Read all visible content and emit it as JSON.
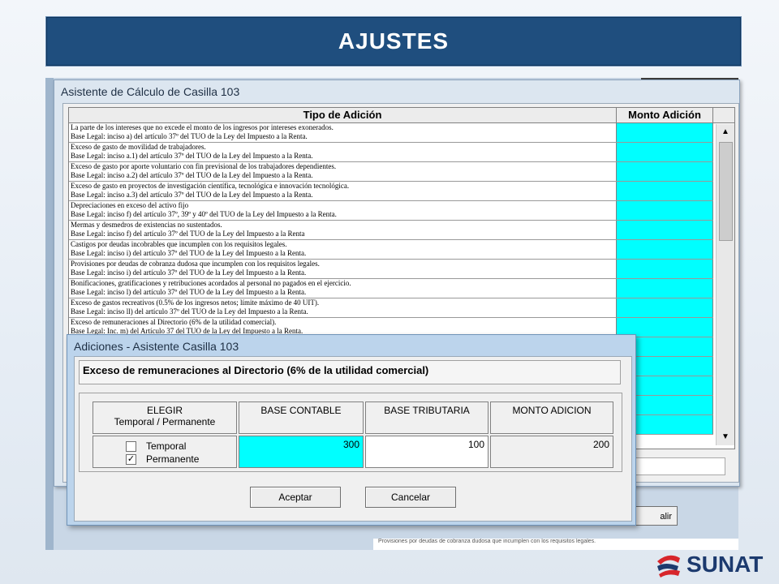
{
  "banner": {
    "title": "AJUSTES"
  },
  "background": {
    "button_label": "alir",
    "footer_text": "Provisiones por deudas de cobranza dudosa que incumplen con los requisitos legales."
  },
  "wizard": {
    "title": "Asistente de Cálculo de Casilla 103",
    "columns": {
      "tipo": "Tipo de Adición",
      "monto": "Monto Adición"
    },
    "rows": [
      {
        "line1": "La parte de los intereses que no excede el monto de los ingresos por intereses exonerados.",
        "line2": "Base Legal: inciso a) del artículo 37º del TUO de la Ley del Impuesto a la Renta."
      },
      {
        "line1": "Exceso de gasto de movilidad de trabajadores.",
        "line2": "Base Legal: inciso a.1) del artículo 37º del TUO de la Ley del Impuesto a la Renta."
      },
      {
        "line1": "Exceso de gasto por aporte voluntario con fin previsional de los trabajadores dependientes.",
        "line2": "Base Legal: inciso a.2) del artículo 37º del TUO de la Ley del Impuesto a la Renta."
      },
      {
        "line1": "Exceso de gasto en proyectos de investigación científica, tecnológica e innovación tecnológica.",
        "line2": "Base Legal: inciso a.3) del artículo 37º del TUO de la Ley del Impuesto a la Renta."
      },
      {
        "line1": "Depreciaciones en exceso del activo fijo",
        "line2": "Base Legal: inciso f) del artículo 37º, 39º y 40º del TUO de la Ley del Impuesto a la Renta."
      },
      {
        "line1": "Mermas y desmedros de existencias no sustentados.",
        "line2": "Base Legal: inciso f) del artículo 37º del TUO de la Ley del Impuesto a la Renta"
      },
      {
        "line1": "Castigos por deudas incobrables que incumplen con los requisitos legales.",
        "line2": "Base Legal: inciso i) del artículo 37º del TUO de la Ley del Impuesto a la Renta."
      },
      {
        "line1": "Provisiones por  deudas de cobranza dudosa que incumplen con los requisitos legales.",
        "line2": "Base Legal: inciso i) del artículo 37º del TUO de la Ley del Impuesto a la Renta."
      },
      {
        "line1": "Bonificaciones, gratificaciones y retribuciones acordados al personal no pagados en el ejercicio.",
        "line2": "Base Legal: inciso l) del artículo 37º del TUO de la Ley del Impuesto a la Renta."
      },
      {
        "line1": "Exceso de gastos recreativos (0.5% de los ingresos netos; límite máximo de 40 UIT).",
        "line2": "Base Legal: inciso ll) del artículo 37º del TUO de la Ley del Impuesto a la Renta."
      },
      {
        "line1": "Exceso de remuneraciones al Directorio (6% de la utilidad comercial).",
        "line2": "Base Legal: Inc. m) del Artículo 37 del TUO de la Ley del Impuesto a la Renta."
      }
    ]
  },
  "dialog": {
    "title": "Adiciones - Asistente Casilla 103",
    "heading": "Exceso de remuneraciones al Directorio (6% de la utilidad comercial)",
    "col_elegir_1": "ELEGIR",
    "col_elegir_2": "Temporal / Permanente",
    "col_base_contable": "BASE CONTABLE",
    "col_base_tributaria": "BASE TRIBUTARIA",
    "col_monto_adicion": "MONTO ADICION",
    "option_temporal": "Temporal",
    "option_permanente": "Permanente",
    "temporal_checked": false,
    "permanente_checked": true,
    "base_contable_value": "300",
    "base_tributaria_value": "100",
    "monto_adicion_value": "200",
    "accept_label": "Aceptar",
    "cancel_label": "Cancelar"
  },
  "logo": {
    "text": "SUNAT"
  },
  "colors": {
    "banner": "#1f4e7e",
    "cyan": "#00ffff",
    "logo_blue": "#1c3a6e",
    "logo_red": "#d7262b"
  }
}
